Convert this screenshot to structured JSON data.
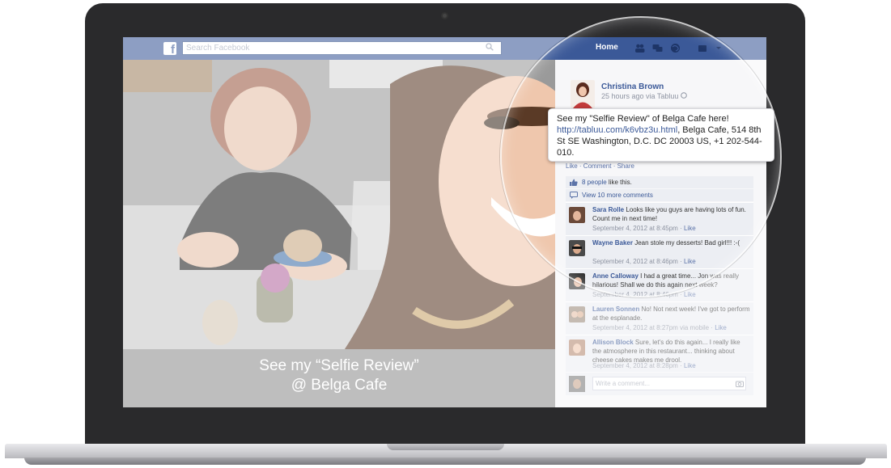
{
  "search": {
    "placeholder": "Search Facebook"
  },
  "nav": {
    "home": "Home"
  },
  "post": {
    "author": "Christina Brown",
    "meta": "25 hours ago via Tabluu",
    "text_before_link": "See my \"Selfie Review\" of Belga Cafe here!",
    "link": "http://tabluu.com/k6vbz3u.html",
    "text_after_link": ", Belga Cafe, 514 8th St SE Washington, D.C. DC 20003 US, +1 202-544-010.",
    "actions": {
      "like": "Like",
      "comment": "Comment",
      "share": "Share",
      "separator": " · "
    },
    "likes": {
      "count_link": "8 people",
      "suffix": " like this."
    },
    "view_more": "View 10 more comments"
  },
  "photo": {
    "caption_line1": "See my “Selfie Review”",
    "caption_line2": "@ Belga Cafe"
  },
  "comments": [
    {
      "name": "Sara Rolle",
      "text": "Looks like you guys are having lots of fun. Count me in next time!",
      "time": "September 4, 2012 at 8:45pm · ",
      "like": "Like"
    },
    {
      "name": "Wayne Baker",
      "text": "Jean stole my desserts! Bad girl!!! :-(",
      "time": "September 4, 2012 at 8:46pm · ",
      "like": "Like"
    },
    {
      "name": "Anne Calloway",
      "text": "I had a great time... Jon was really hilarious! Shall we do this again next week?",
      "time": "September 4, 2012 at 8:46pm · ",
      "like": "Like"
    },
    {
      "name": "Lauren Sonnen",
      "text": "No! Not next week! I've got to perform at the esplanade.",
      "time": "September 4, 2012 at 8:27pm via mobile · ",
      "like": "Like"
    },
    {
      "name": "Allison Block",
      "text": "Sure, let's do this again... I really like the atmosphere in this restaurant... thinking about cheese cakes makes me drool.",
      "time": "September 4, 2012 at 8:28pm · ",
      "like": "Like"
    }
  ],
  "composer": {
    "placeholder": "Write a comment..."
  },
  "colors": {
    "facebook_blue": "#3b5998",
    "link_blue": "#3b5998",
    "column_bg": "#eceef3"
  }
}
